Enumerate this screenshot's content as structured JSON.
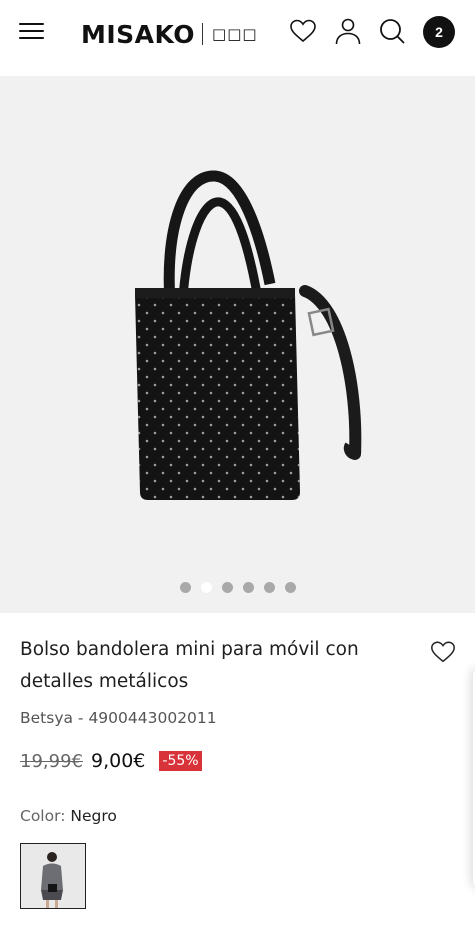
{
  "header": {
    "logo_text": "MISAKO",
    "logo_glyphs": "□□□",
    "cart_count": "2",
    "icons": [
      "menu-icon",
      "heart-icon",
      "user-icon",
      "search-icon",
      "cart-badge"
    ]
  },
  "gallery": {
    "image_subject": "black studded mini crossbody bag",
    "slide_count": 6,
    "active_slide": 2
  },
  "product": {
    "title": "Bolso bandolera mini para móvil con detalles metálicos",
    "reference": "Betsya - 4900443002011",
    "old_price": "19,99€",
    "price": "9,00€",
    "discount": "-55%",
    "color_label": "Color:",
    "color_value": "Negro"
  },
  "colors": {
    "accent_red": "#d9333a",
    "badge_black": "#111111",
    "gallery_bg": "#f1f1f1"
  }
}
